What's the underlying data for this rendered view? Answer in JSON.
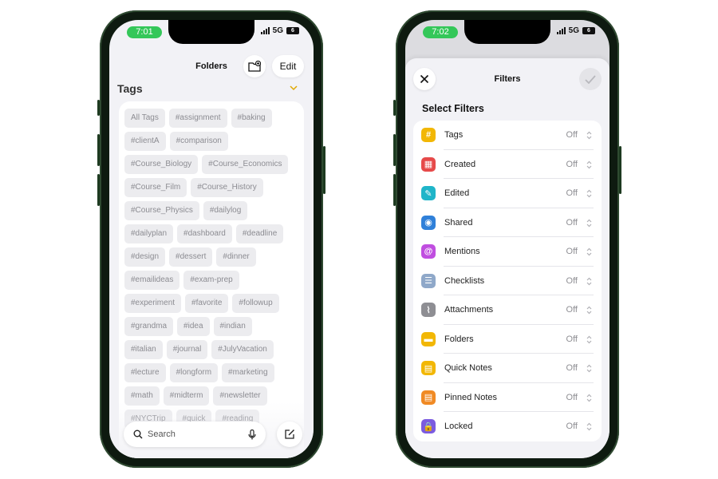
{
  "left_phone": {
    "status": {
      "time": "7:01",
      "network": "5G",
      "battery": "6"
    },
    "header": {
      "title": "Folders",
      "edit_label": "Edit",
      "new_folder_icon": "folder-plus-icon"
    },
    "tags_section": {
      "title": "Tags",
      "chevron_icon": "chevron-down-icon",
      "chevron_color": "#e0a800"
    },
    "tag_rows": [
      [
        "All Tags",
        "#assignment",
        "#baking"
      ],
      [
        "#clientA",
        "#comparison"
      ],
      [
        "#Course_Biology",
        "#Course_Economics"
      ],
      [
        "#Course_Film",
        "#Course_History"
      ],
      [
        "#Course_Physics",
        "#dailylog"
      ],
      [
        "#dailyplan",
        "#dashboard",
        "#deadline"
      ],
      [
        "#design",
        "#dessert",
        "#dinner"
      ],
      [
        "#emailideas",
        "#exam-prep"
      ],
      [
        "#experiment",
        "#favorite",
        "#followup"
      ],
      [
        "#grandma",
        "#idea",
        "#indian"
      ],
      [
        "#italian",
        "#journal",
        "#JulyVacation"
      ],
      [
        "#lecture",
        "#longform",
        "#marketing"
      ],
      [
        "#math",
        "#midterm",
        "#newsletter"
      ],
      [
        "#NYCTrip",
        "#quick",
        "#reading"
      ]
    ],
    "search": {
      "placeholder": "Search",
      "icon": "search-icon",
      "mic_icon": "microphone-icon"
    },
    "compose_icon": "compose-icon"
  },
  "right_phone": {
    "status": {
      "time": "7:02",
      "network": "5G",
      "battery": "6"
    },
    "sheet": {
      "title": "Filters",
      "section_title": "Select Filters",
      "close_icon": "close-icon",
      "done_icon": "checkmark-icon"
    },
    "filters": [
      {
        "label": "Tags",
        "value": "Off",
        "icon": "hashtag-icon",
        "color": "#f2b705",
        "glyph": "#"
      },
      {
        "label": "Created",
        "value": "Off",
        "icon": "calendar-icon",
        "color": "#e64a4a",
        "glyph": "▦"
      },
      {
        "label": "Edited",
        "value": "Off",
        "icon": "pencil-icon",
        "color": "#1fb5c9",
        "glyph": "✎"
      },
      {
        "label": "Shared",
        "value": "Off",
        "icon": "people-icon",
        "color": "#2f80d9",
        "glyph": "◉"
      },
      {
        "label": "Mentions",
        "value": "Off",
        "icon": "at-icon",
        "color": "#c04ee0",
        "glyph": "@"
      },
      {
        "label": "Checklists",
        "value": "Off",
        "icon": "checklist-icon",
        "color": "#8fa8c9",
        "glyph": "☰"
      },
      {
        "label": "Attachments",
        "value": "Off",
        "icon": "paperclip-icon",
        "color": "#8e8e93",
        "glyph": "⌇"
      },
      {
        "label": "Folders",
        "value": "Off",
        "icon": "folder-icon",
        "color": "#f2b705",
        "glyph": "▬"
      },
      {
        "label": "Quick Notes",
        "value": "Off",
        "icon": "quick-note-icon",
        "color": "#f2b705",
        "glyph": "▤"
      },
      {
        "label": "Pinned Notes",
        "value": "Off",
        "icon": "pinned-note-icon",
        "color": "#f08a24",
        "glyph": "▤"
      },
      {
        "label": "Locked",
        "value": "Off",
        "icon": "lock-icon",
        "color": "#7b5be0",
        "glyph": "🔒"
      }
    ]
  }
}
